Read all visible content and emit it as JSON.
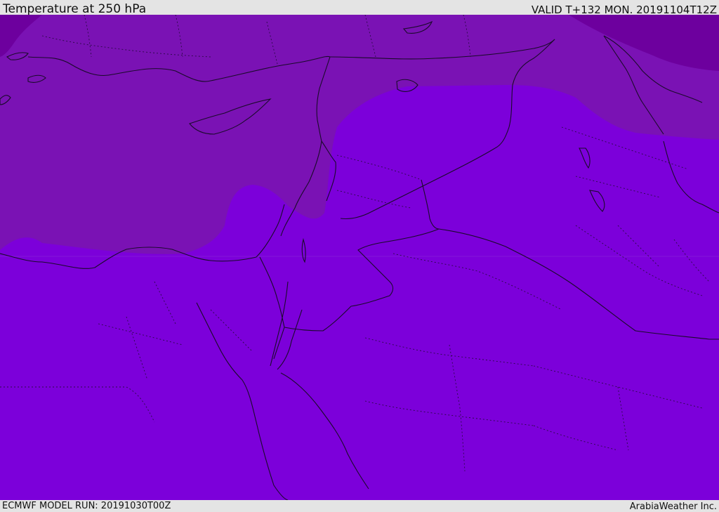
{
  "header": {
    "title": "Temperature at 250 hPa",
    "valid_time": "VALID T+132 MON. 20191104T12Z"
  },
  "footer": {
    "model_run": "ECMWF MODEL RUN: 20191030T00Z",
    "brand": "ArabiaWeather Inc."
  },
  "colors": {
    "dark_band": "#6d009e",
    "mid_band": "#7a12b4",
    "light_band": "#7c00da",
    "borders": "#1a0a2a",
    "frame_bg": "#e4e4e4"
  }
}
